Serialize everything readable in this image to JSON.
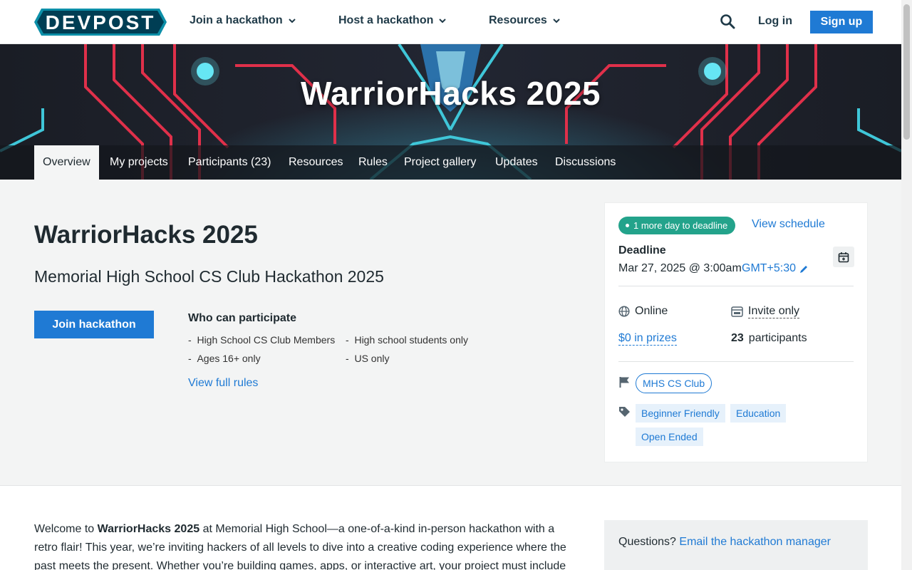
{
  "brand": {
    "logo_text": "DEVPOST",
    "accent": "#1f7ad4",
    "logo_color": "#003e54",
    "status_green": "#23a38b"
  },
  "nav": {
    "items": [
      {
        "label": "Join a hackathon"
      },
      {
        "label": "Host a hackathon"
      },
      {
        "label": "Resources"
      }
    ],
    "login": "Log in",
    "signup": "Sign up"
  },
  "banner": {
    "title": "WarriorHacks 2025",
    "tabs": [
      "Overview",
      "My projects",
      "Participants (23)",
      "Resources",
      "Rules",
      "Project gallery",
      "Updates",
      "Discussions"
    ],
    "active_tab": "Overview"
  },
  "hero": {
    "title": "WarriorHacks 2025",
    "tagline": "Memorial High School CS Club Hackathon 2025",
    "join_label": "Join hackathon",
    "who_heading": "Who can participate",
    "eligibility": [
      "High School CS Club Members",
      "High school students only",
      "Ages 16+ only",
      "US only"
    ],
    "rules_link": "View full rules"
  },
  "sidebar": {
    "status": "1 more day to deadline",
    "schedule_link": "View schedule",
    "deadline_label": "Deadline",
    "deadline_date": "Mar 27, 2025 @ 3:00am",
    "timezone": "GMT+5:30",
    "location": "Online",
    "access": "Invite only",
    "prizes": "$0 in prizes",
    "participants_count": "23",
    "participants_label": "participants",
    "host": "MHS CS Club",
    "themes": [
      "Beginner Friendly",
      "Education",
      "Open Ended"
    ]
  },
  "body": {
    "intro_a": "Welcome to ",
    "intro_bold": "WarriorHacks 2025",
    "intro_b": " at Memorial High School—a one-of-a-kind in-person hackathon with a retro flair! This year, we’re inviting hackers of all levels to dive into a creative coding experience where the past meets the present. Whether you’re building games, apps, or interactive art, your project must include"
  },
  "questions": {
    "prompt": "Questions?",
    "link": "Email the hackathon manager"
  }
}
